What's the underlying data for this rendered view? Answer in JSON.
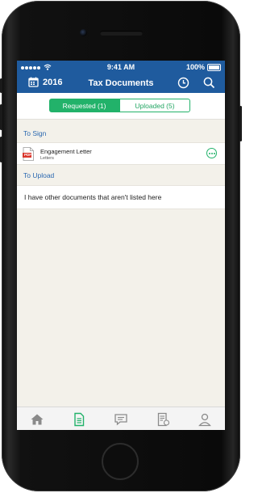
{
  "status_bar": {
    "carrier_icon": "signal-dots-icon",
    "wifi_icon": "wifi-icon",
    "time": "9:41 AM",
    "battery_percent": "100%",
    "battery_icon": "battery-icon"
  },
  "nav_bar": {
    "year": "2016",
    "year_icon": "calendar-icon",
    "title": "Tax Documents",
    "history_icon": "clock-icon",
    "search_icon": "search-icon"
  },
  "segments": {
    "requested_label": "Requested (1)",
    "uploaded_label": "Uploaded (5)",
    "active": "requested"
  },
  "sections": {
    "to_sign": {
      "header": "To Sign",
      "items": [
        {
          "title": "Engagement Letter",
          "subtitle": "Letters",
          "file_type": "PDF"
        }
      ]
    },
    "to_upload": {
      "header": "To Upload",
      "item_text": "I have other documents that aren't listed here"
    }
  },
  "tab_bar": {
    "items": [
      {
        "icon": "home-icon",
        "active": false
      },
      {
        "icon": "document-icon",
        "active": true
      },
      {
        "icon": "chat-icon",
        "active": false
      },
      {
        "icon": "invoice-icon",
        "active": false
      },
      {
        "icon": "profile-icon",
        "active": false
      }
    ]
  },
  "colors": {
    "header_blue": "#1f5b9e",
    "accent_green": "#22b26a",
    "section_blue": "#2a68b0",
    "background": "#f3f1ea"
  }
}
